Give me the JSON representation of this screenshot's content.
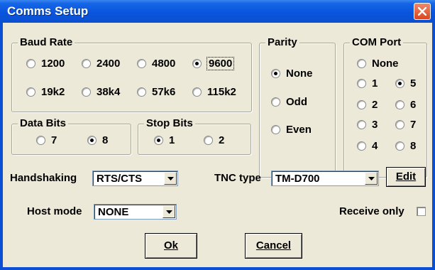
{
  "window": {
    "title": "Comms Setup"
  },
  "baud": {
    "label": "Baud Rate",
    "options": [
      "1200",
      "2400",
      "4800",
      "9600",
      "19k2",
      "38k4",
      "57k6",
      "115k2"
    ],
    "selected": "9600"
  },
  "parity": {
    "label": "Parity",
    "options": [
      "None",
      "Odd",
      "Even"
    ],
    "selected": "None"
  },
  "com": {
    "label": "COM Port",
    "none": "None",
    "options": [
      "1",
      "2",
      "3",
      "4",
      "5",
      "6",
      "7",
      "8"
    ],
    "selected": "5"
  },
  "databits": {
    "label": "Data Bits",
    "options": [
      "7",
      "8"
    ],
    "selected": "8"
  },
  "stopbits": {
    "label": "Stop Bits",
    "options": [
      "1",
      "2"
    ],
    "selected": "1"
  },
  "handshaking": {
    "label": "Handshaking",
    "value": "RTS/CTS"
  },
  "tnc": {
    "label": "TNC type",
    "value": "TM-D700",
    "edit_label": "Edit"
  },
  "hostmode": {
    "label": "Host mode",
    "value": "NONE"
  },
  "receiveonly": {
    "label": "Receive only",
    "checked": false
  },
  "buttons": {
    "ok": "Ok",
    "cancel": "Cancel"
  }
}
